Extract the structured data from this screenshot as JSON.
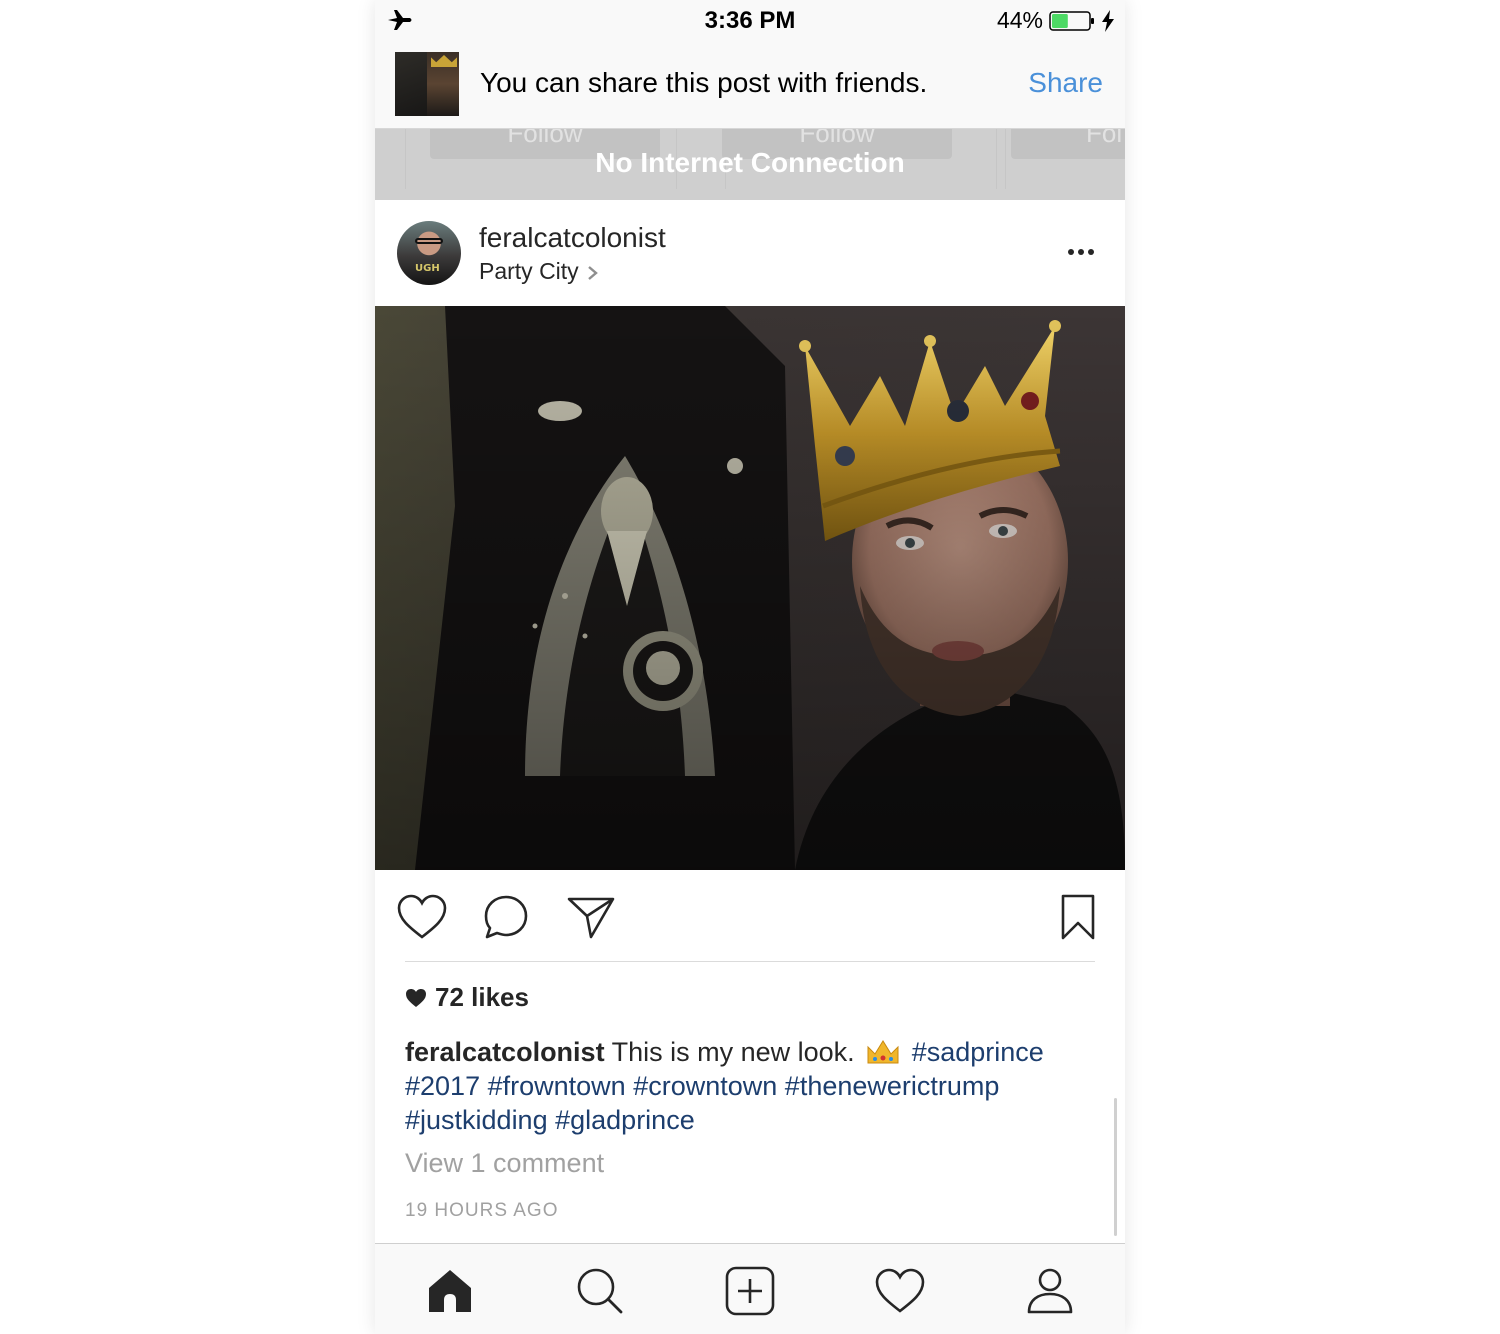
{
  "status_bar": {
    "time": "3:36 PM",
    "battery_percent": "44%",
    "battery_level": 0.44,
    "airplane_icon": "airplane-icon",
    "charging_icon": "bolt-icon"
  },
  "share_banner": {
    "message": "You can share this post with friends.",
    "action_label": "Share",
    "action_color": "#4a90d9"
  },
  "connection_banner": {
    "message": "No Internet Connection",
    "ghost_buttons": [
      "Follow",
      "Follow",
      "Fol"
    ]
  },
  "post": {
    "username": "feralcatcolonist",
    "location": "Party City",
    "avatar_text": "UGH",
    "more_icon": "more-horizontal-icon",
    "actions": [
      "heart-icon",
      "comment-icon",
      "send-icon",
      "bookmark-icon"
    ],
    "likes": "72 likes",
    "caption": {
      "username": "feralcatcolonist",
      "text": "This is my new look.",
      "emoji": "crown-emoji",
      "hashtags": [
        "#sadprince",
        "#2017",
        "#frowntown",
        "#crowntown",
        "#thenewerictrump",
        "#justkidding",
        "#gladprince"
      ]
    },
    "view_comments": "View 1 comment",
    "timestamp": "19 HOURS AGO",
    "link_color": "#1d3e6e"
  },
  "tab_bar": {
    "tabs": [
      "home-icon",
      "search-icon",
      "new-post-icon",
      "activity-heart-icon",
      "profile-icon"
    ]
  }
}
